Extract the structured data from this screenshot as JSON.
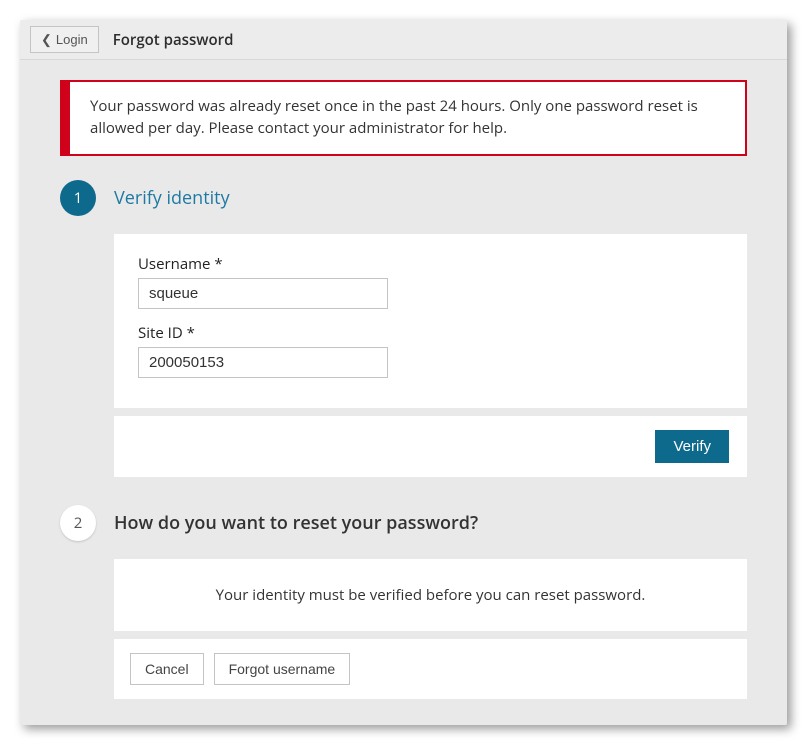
{
  "topbar": {
    "login_btn": "Login",
    "page_title": "Forgot password"
  },
  "alert": {
    "message": "Your password was already reset once in the past 24 hours. Only one password reset is allowed per day. Please contact your administrator for help."
  },
  "step1": {
    "number": "1",
    "title": "Verify identity",
    "username_label": "Username *",
    "username_value": "squeue",
    "siteid_label": "Site ID *",
    "siteid_value": "200050153",
    "verify_btn": "Verify"
  },
  "step2": {
    "number": "2",
    "title": "How do you want to reset your password?",
    "notice": "Your identity must be verified before you can reset password.",
    "cancel_btn": "Cancel",
    "forgot_username_btn": "Forgot username"
  }
}
